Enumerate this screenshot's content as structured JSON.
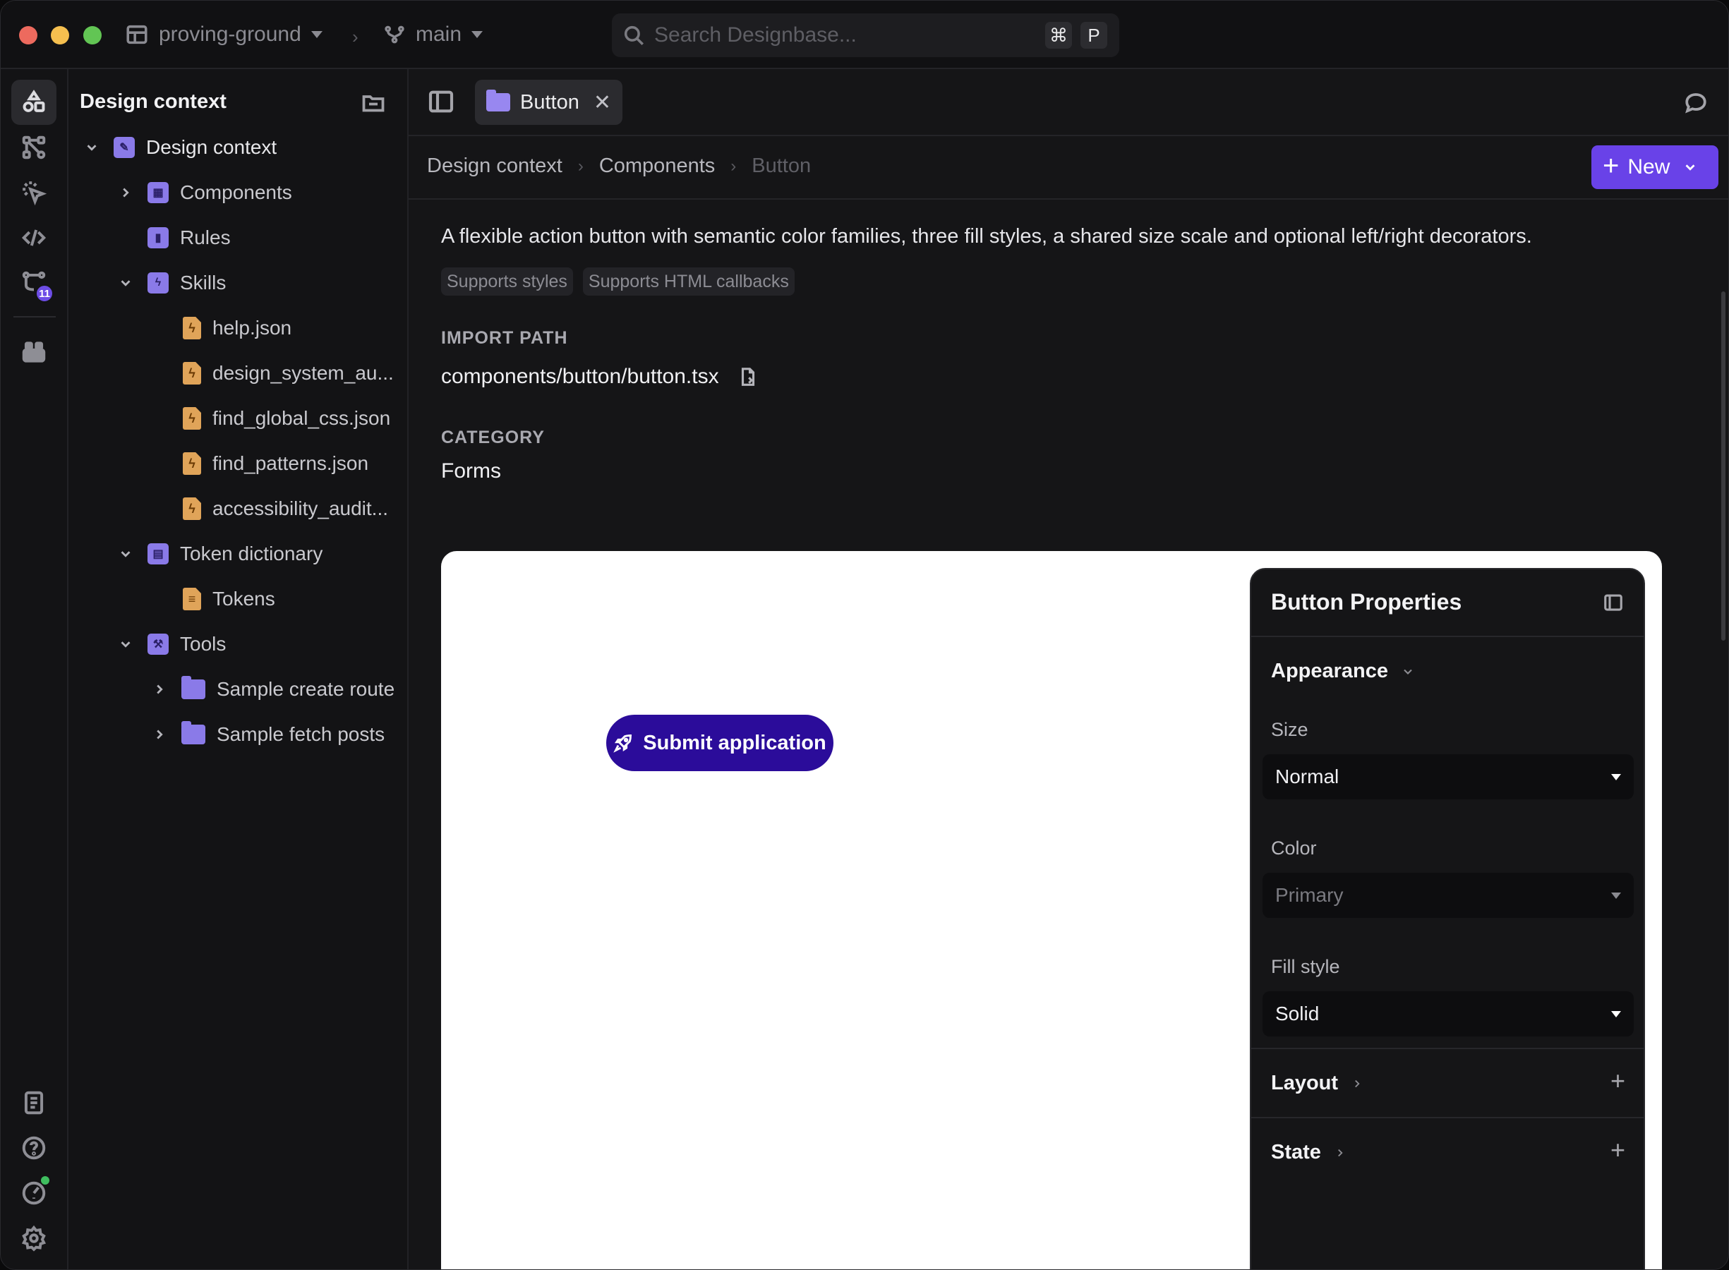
{
  "titlebar": {
    "project": "proving-ground",
    "branch": "main",
    "search_placeholder": "Search Designbase...",
    "shortcut_cmd": "⌘",
    "shortcut_key": "P"
  },
  "rail": {
    "badge_count": "11"
  },
  "sidebar": {
    "title": "Design context",
    "tree": {
      "root": "Design context",
      "components": "Components",
      "rules": "Rules",
      "skills": "Skills",
      "skill_files": [
        "help.json",
        "design_system_au...",
        "find_global_css.json",
        "find_patterns.json",
        "accessibility_audit..."
      ],
      "token_dictionary": "Token dictionary",
      "tokens": "Tokens",
      "tools": "Tools",
      "tool_items": [
        "Sample create route",
        "Sample fetch posts"
      ]
    }
  },
  "tab": {
    "label": "Button"
  },
  "breadcrumb": [
    "Design context",
    "Components",
    "Button"
  ],
  "new_button": "New",
  "component": {
    "description": "A flexible action button with semantic color families, three fill styles, a shared size scale and optional left/right decorators.",
    "chips": [
      "Supports styles",
      "Supports HTML callbacks"
    ],
    "import_label": "IMPORT PATH",
    "import_path": "components/button/button.tsx",
    "category_label": "CATEGORY",
    "category": "Forms"
  },
  "preview": {
    "button_label": "Submit application",
    "button_color": "#2b0c9a"
  },
  "properties": {
    "title": "Button Properties",
    "appearance": "Appearance",
    "size_label": "Size",
    "size_value": "Normal",
    "color_label": "Color",
    "color_value": "Primary",
    "fill_label": "Fill style",
    "fill_value": "Solid",
    "layout": "Layout",
    "state": "State"
  },
  "colors": {
    "accent": "#6942e8",
    "folder_purple": "#8a7ae8",
    "file_orange": "#e0a459"
  }
}
